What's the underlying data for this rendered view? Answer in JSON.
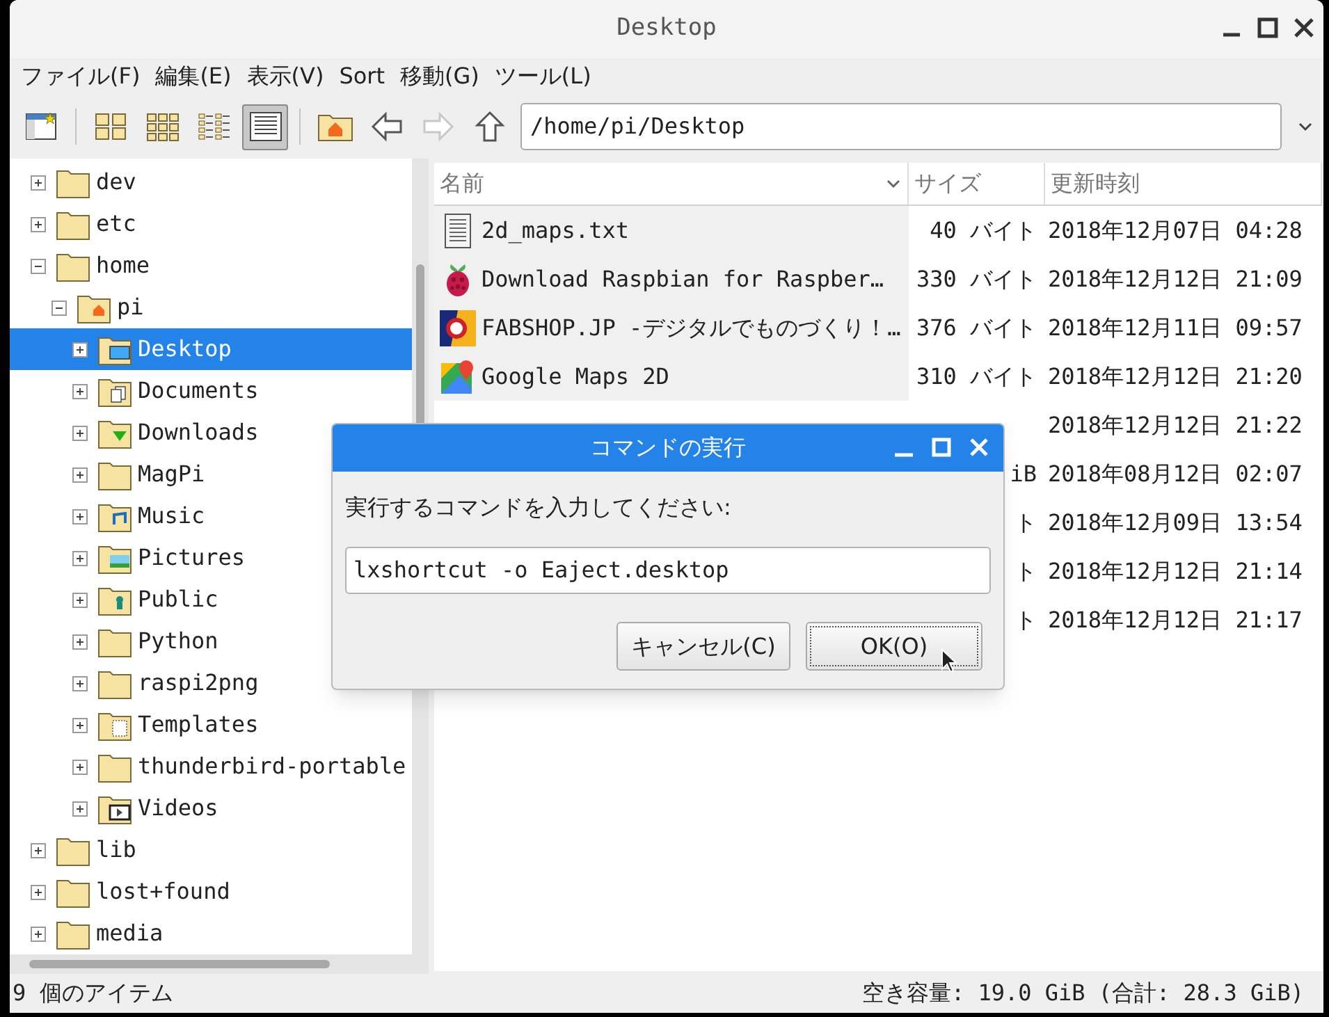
{
  "window": {
    "title": "Desktop"
  },
  "menu": [
    {
      "label": "ファイル(F)"
    },
    {
      "label": "編集(E)"
    },
    {
      "label": "表示(V)"
    },
    {
      "label": "Sort"
    },
    {
      "label": "移動(G)"
    },
    {
      "label": "ツール(L)"
    }
  ],
  "toolbar": {
    "groups": [
      [
        {
          "kind": "new-window"
        }
      ],
      [
        {
          "kind": "icons",
          "selected": false
        },
        {
          "kind": "thumbs",
          "selected": false
        },
        {
          "kind": "compact",
          "selected": false
        },
        {
          "kind": "list",
          "selected": true
        }
      ],
      [
        {
          "kind": "home"
        },
        {
          "kind": "back",
          "disabled": false
        },
        {
          "kind": "forward",
          "disabled": true
        },
        {
          "kind": "up",
          "disabled": false
        }
      ]
    ],
    "path": "/home/pi/Desktop"
  },
  "tree": [
    {
      "label": "dev",
      "kind": "folder",
      "expanded": false,
      "selected": false
    },
    {
      "label": "etc",
      "kind": "folder",
      "expanded": false,
      "selected": false
    },
    {
      "label": "home",
      "kind": "folder",
      "expanded": true,
      "selected": false,
      "children": [
        {
          "label": "pi",
          "kind": "home",
          "expanded": true,
          "selected": false,
          "children": [
            {
              "label": "Desktop",
              "kind": "desktop",
              "expanded": false,
              "selected": true
            },
            {
              "label": "Documents",
              "kind": "documents",
              "expanded": false,
              "selected": false
            },
            {
              "label": "Downloads",
              "kind": "downloads",
              "expanded": false,
              "selected": false
            },
            {
              "label": "MagPi",
              "kind": "folder",
              "expanded": false,
              "selected": false
            },
            {
              "label": "Music",
              "kind": "music",
              "expanded": false,
              "selected": false
            },
            {
              "label": "Pictures",
              "kind": "pictures",
              "expanded": false,
              "selected": false
            },
            {
              "label": "Public",
              "kind": "public",
              "expanded": false,
              "selected": false
            },
            {
              "label": "Python",
              "kind": "folder",
              "expanded": false,
              "selected": false
            },
            {
              "label": "raspi2png",
              "kind": "folder",
              "expanded": false,
              "selected": false
            },
            {
              "label": "Templates",
              "kind": "templates",
              "expanded": false,
              "selected": false
            },
            {
              "label": "thunderbird-portable",
              "kind": "folder",
              "expanded": false,
              "selected": false
            },
            {
              "label": "Videos",
              "kind": "videos",
              "expanded": false,
              "selected": false
            }
          ]
        }
      ]
    },
    {
      "label": "lib",
      "kind": "folder",
      "expanded": false,
      "selected": false
    },
    {
      "label": "lost+found",
      "kind": "folder",
      "expanded": false,
      "selected": false
    },
    {
      "label": "media",
      "kind": "folder",
      "expanded": false,
      "selected": false
    }
  ],
  "table": {
    "columns": [
      {
        "label": "名前",
        "sorted": true
      },
      {
        "label": "サイズ",
        "sorted": false
      },
      {
        "label": "更新時刻",
        "sorted": false
      }
    ],
    "rows": [
      {
        "kind": "text",
        "name": "2d_maps.txt",
        "size": "40 バイト",
        "modified": "2018年12月07日 04:28"
      },
      {
        "kind": "raspberry",
        "name": "Download Raspbian for Raspber…",
        "size": "330 バイト",
        "modified": "2018年12月12日 21:09"
      },
      {
        "kind": "shop",
        "name": "FABSHOP.JP -デジタルでものづくり！…",
        "size": "376 バイト",
        "modified": "2018年12月11日 09:57"
      },
      {
        "kind": "map",
        "name": "Google Maps 2D",
        "size": "310 バイト",
        "modified": "2018年12月12日 21:20"
      },
      {
        "kind": "hidden",
        "modified": "2018年12月12日 21:22"
      },
      {
        "kind": "hidden",
        "size": "iB",
        "modified": "2018年08月12日 02:07"
      },
      {
        "kind": "hidden",
        "size": "ト",
        "modified": "2018年12月09日 13:54"
      },
      {
        "kind": "hidden",
        "size": "ト",
        "modified": "2018年12月12日 21:14"
      },
      {
        "kind": "hidden",
        "size": "ト",
        "modified": "2018年12月12日 21:17"
      }
    ]
  },
  "status_bar": {
    "items": "9 個のアイテム",
    "free": "空き容量: 19.0 GiB (合計: 28.3 GiB)"
  },
  "dialog": {
    "title": "コマンドの実行",
    "prompt": "実行するコマンドを入力してください:",
    "value": "lxshortcut -o Eaject.desktop",
    "buttons": [
      {
        "label": "キャンセル(C)",
        "focused": false
      },
      {
        "label": "OK(O)",
        "focused": true
      }
    ]
  }
}
